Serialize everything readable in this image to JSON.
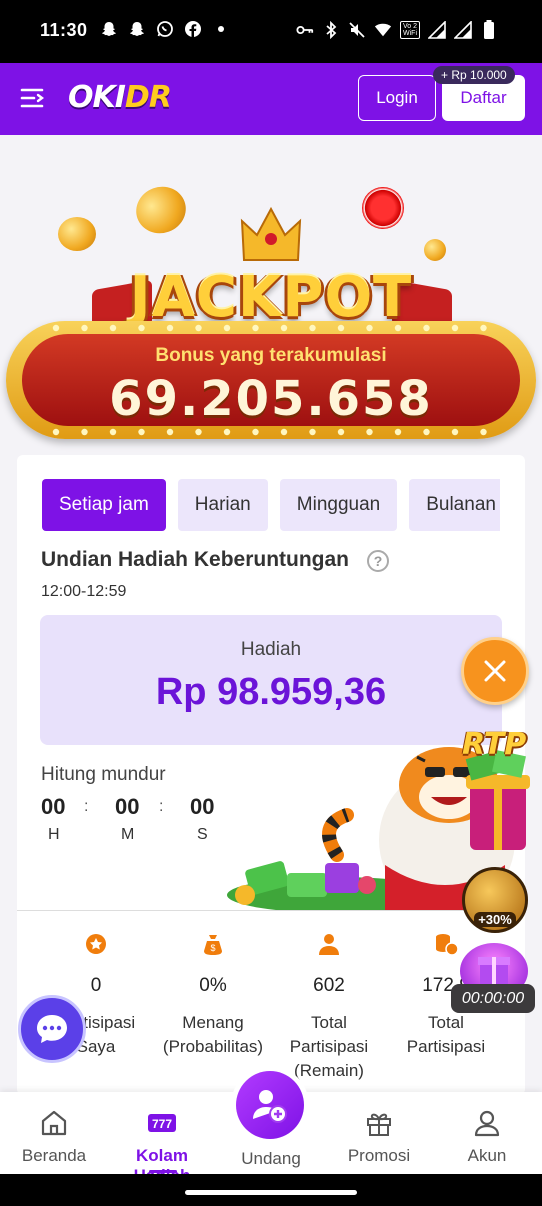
{
  "status_bar": {
    "time": "11:30",
    "left_icons": [
      "snapchat-icon",
      "snapchat-icon",
      "whatsapp-icon",
      "facebook-icon",
      "dot-icon"
    ],
    "right_icons": [
      "key-icon",
      "bluetooth-icon",
      "mute-icon",
      "wifi-icon",
      "volte-icon",
      "signal-icon",
      "signal-icon",
      "battery-icon"
    ],
    "volte_text": "Vo 2 WiFi"
  },
  "header": {
    "logo_left": "OKI",
    "logo_right": "DR",
    "login_label": "Login",
    "register_label": "Daftar",
    "register_bonus": "+ Rp 10.000",
    "brand_color": "#7e12e6"
  },
  "jackpot": {
    "title": "JACKPOT",
    "subtitle": "Bonus yang terakumulasi",
    "amount": "69.205.658"
  },
  "tabs": [
    {
      "label": "Setiap jam",
      "active": true
    },
    {
      "label": "Harian",
      "active": false
    },
    {
      "label": "Mingguan",
      "active": false
    },
    {
      "label": "Bulanan",
      "active": false
    }
  ],
  "draw": {
    "title": "Undian Hadiah Keberuntungan",
    "time_range": "12:00-12:59",
    "prize_label": "Hadiah",
    "prize_amount": "Rp 98.959,36",
    "countdown_label": "Hitung mundur",
    "countdown": {
      "hours": "00",
      "minutes": "00",
      "seconds": "00",
      "hours_unit": "H",
      "minutes_unit": "M",
      "seconds_unit": "S",
      "separator": ":"
    }
  },
  "stats": [
    {
      "icon": "medal-icon",
      "value": "0",
      "label_line1": "Partisipasi",
      "label_line2": "Saya"
    },
    {
      "icon": "money-bag-icon",
      "value": "0%",
      "label_line1": "Menang",
      "label_line2": "(Probabilitas)"
    },
    {
      "icon": "person-icon",
      "value": "602",
      "label_line1": "Total",
      "label_line2": "Partisipasi",
      "label_line3": "(Remain)"
    },
    {
      "icon": "coins-icon",
      "value": "172,9",
      "label_line1": "Total",
      "label_line2": "Partisipasi"
    }
  ],
  "floating": {
    "rtp_label": "RTP",
    "bonus_badge": "+30%",
    "timer": "00:00:00"
  },
  "bottom_nav": [
    {
      "label": "Beranda",
      "icon": "home-icon"
    },
    {
      "label": "Kolam Hadiah",
      "icon": "slot-777-icon",
      "active": true
    },
    {
      "label": "Undang",
      "icon": "invite-user-icon"
    },
    {
      "label": "Promosi",
      "icon": "gift-icon"
    },
    {
      "label": "Akun",
      "icon": "account-icon"
    }
  ]
}
